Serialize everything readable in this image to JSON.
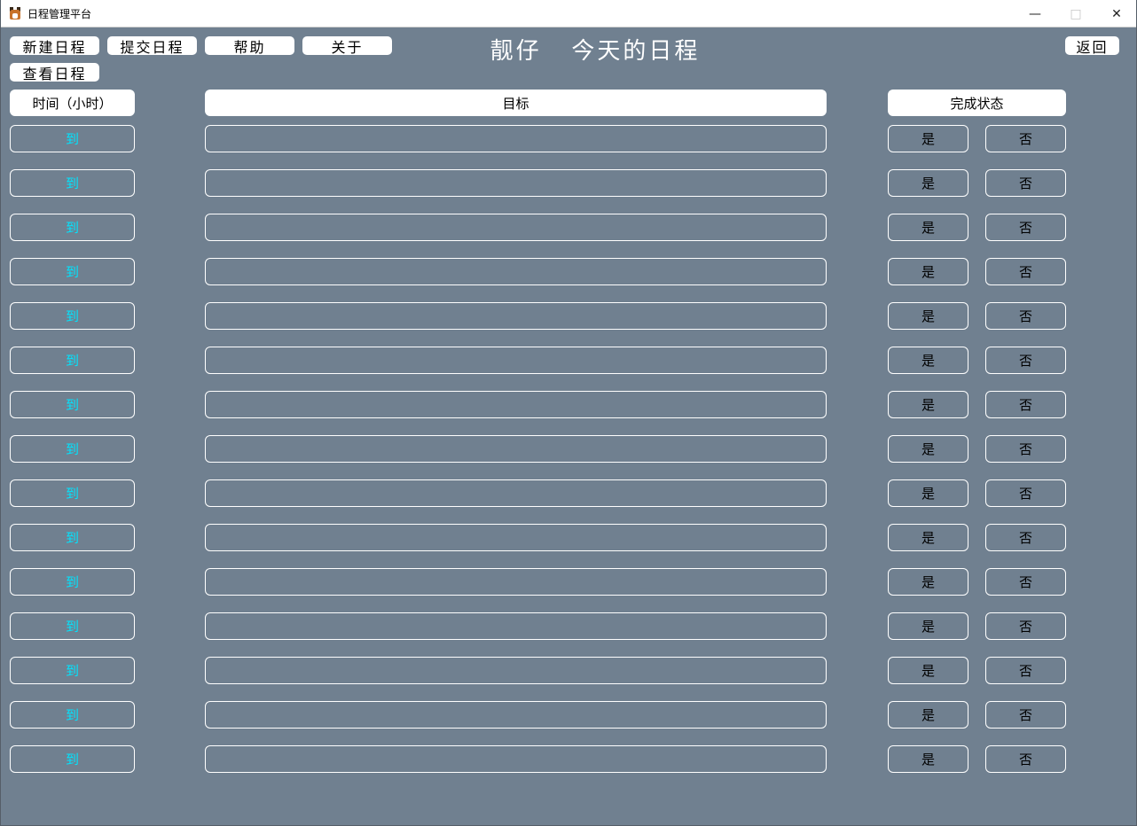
{
  "window": {
    "title": "日程管理平台",
    "minimize_glyph": "—",
    "maximize_glyph": "□",
    "close_glyph": "✕"
  },
  "menu": {
    "new_schedule": "新建日程",
    "submit_schedule": "提交日程",
    "help": "帮助",
    "about": "关于",
    "back": "返回",
    "view_schedule": "查看日程"
  },
  "heading": "靓仔   今天的日程",
  "columns": {
    "time": "时间（小时）",
    "goal": "目标",
    "status": "完成状态"
  },
  "rows": [
    {
      "time": "到",
      "goal": "",
      "yes": "是",
      "no": "否"
    },
    {
      "time": "到",
      "goal": "",
      "yes": "是",
      "no": "否"
    },
    {
      "time": "到",
      "goal": "",
      "yes": "是",
      "no": "否"
    },
    {
      "time": "到",
      "goal": "",
      "yes": "是",
      "no": "否"
    },
    {
      "time": "到",
      "goal": "",
      "yes": "是",
      "no": "否"
    },
    {
      "time": "到",
      "goal": "",
      "yes": "是",
      "no": "否"
    },
    {
      "time": "到",
      "goal": "",
      "yes": "是",
      "no": "否"
    },
    {
      "time": "到",
      "goal": "",
      "yes": "是",
      "no": "否"
    },
    {
      "time": "到",
      "goal": "",
      "yes": "是",
      "no": "否"
    },
    {
      "time": "到",
      "goal": "",
      "yes": "是",
      "no": "否"
    },
    {
      "time": "到",
      "goal": "",
      "yes": "是",
      "no": "否"
    },
    {
      "time": "到",
      "goal": "",
      "yes": "是",
      "no": "否"
    },
    {
      "time": "到",
      "goal": "",
      "yes": "是",
      "no": "否"
    },
    {
      "time": "到",
      "goal": "",
      "yes": "是",
      "no": "否"
    },
    {
      "time": "到",
      "goal": "",
      "yes": "是",
      "no": "否"
    }
  ],
  "colors": {
    "background": "#708090",
    "time_text": "#00e5ff",
    "cell_border": "#ffffff"
  }
}
